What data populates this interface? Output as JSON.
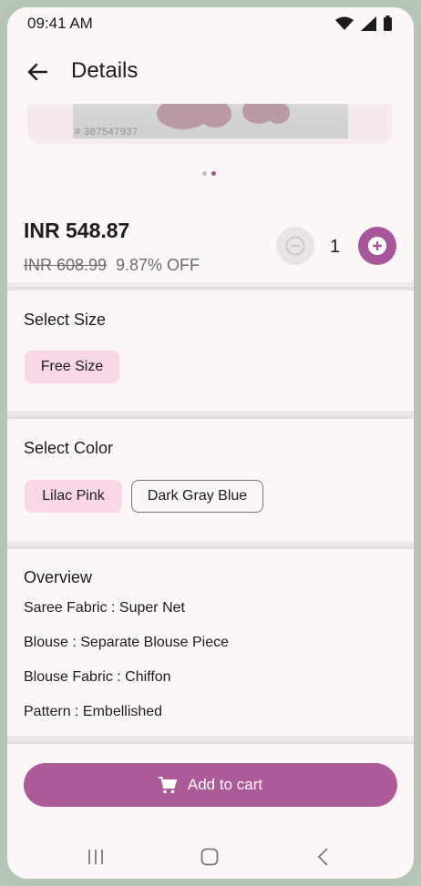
{
  "status_bar": {
    "time": "09:41 AM"
  },
  "app_bar": {
    "title": "Details"
  },
  "image": {
    "caption": "# 387547937"
  },
  "carousel": {
    "count": 2,
    "active_index": 1
  },
  "price": {
    "current": "INR 548.87",
    "original": "INR 608.99",
    "discount": "9.87% OFF"
  },
  "quantity": {
    "value": "1"
  },
  "size": {
    "title": "Select Size",
    "options": [
      {
        "label": "Free Size",
        "selected": true
      }
    ]
  },
  "color": {
    "title": "Select Color",
    "options": [
      {
        "label": "Lilac Pink",
        "selected": true
      },
      {
        "label": "Dark Gray Blue",
        "selected": false
      }
    ]
  },
  "overview": {
    "title": "Overview",
    "items": [
      "Saree Fabric : Super Net",
      "Blouse : Separate Blouse Piece",
      "Blouse Fabric : Chiffon",
      "Pattern : Embellished"
    ]
  },
  "cart": {
    "label": "Add to cart"
  },
  "colors": {
    "accent": "#ad5a99",
    "chip_selected": "#fad7e6",
    "background": "#fdf6f6"
  }
}
